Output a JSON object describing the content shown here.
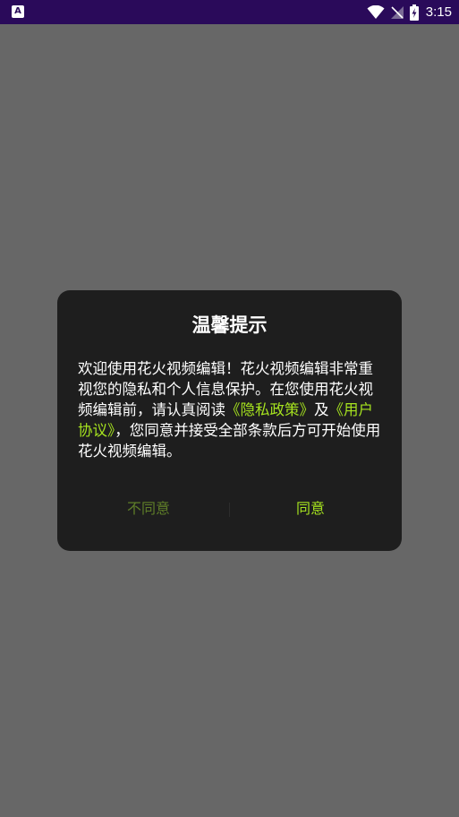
{
  "status_bar": {
    "time": "3:15",
    "background": "#2a0a5a",
    "icons": [
      "app-notification-icon",
      "wifi-icon",
      "no-signal-icon",
      "battery-charging-icon"
    ]
  },
  "dialog": {
    "title": "温馨提示",
    "body_intro": "欢迎使用花火视频编辑！花火视频编辑非常重视您的隐私和个人信息保护。在您使用花火视频编辑前，请认真阅读",
    "privacy_link": "《隐私政策》",
    "connector": "及",
    "agreement_link": "《用户协议》",
    "body_outro": "，您同意并接受全部条款后方可开始使用花火视频编辑。",
    "disagree_label": "不同意",
    "agree_label": "同意"
  },
  "colors": {
    "overlay": "#676767",
    "dialog_bg": "#1e1e1e",
    "accent": "#a6e31f",
    "disagree": "#5f7e28"
  }
}
